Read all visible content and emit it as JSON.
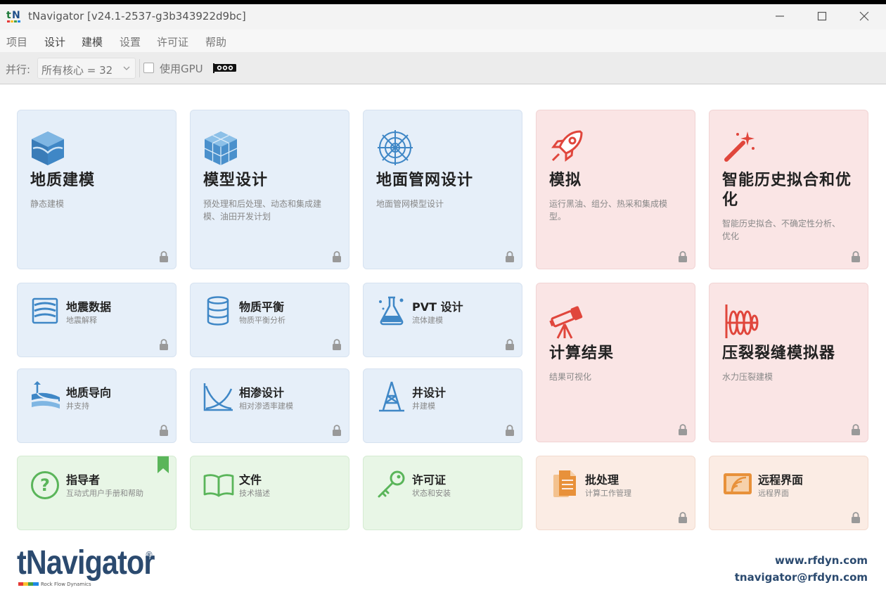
{
  "window": {
    "title": "tNavigator [v24.1-2537-g3b343922d9bc]",
    "minimize_label": "—",
    "maximize_label": "☐",
    "close_label": "✕"
  },
  "menu": {
    "items": [
      "项目",
      "设计",
      "建模",
      "设置",
      "许可证",
      "帮助"
    ],
    "highlighted": [
      "设计",
      "建模"
    ]
  },
  "toolbar": {
    "parallel_label": "并行:",
    "cores_value": "所有核心 = 32",
    "gpu_label": "使用GPU",
    "gpu_checked": false
  },
  "tiles": {
    "geo": {
      "title": "地质建模",
      "desc": "静态建模"
    },
    "model": {
      "title": "模型设计",
      "desc1": "预处理和后处理、动态和集成建",
      "desc2": "模、油田开发计划"
    },
    "network": {
      "title": "地面管网设计",
      "desc": "地面管网模型设计"
    },
    "sim": {
      "title": "模拟",
      "desc1": "运行黑油、组分、热采和集成模",
      "desc2": "型。"
    },
    "ahm": {
      "title1": "智能历史拟合和优",
      "title2": "化",
      "desc1": "智能历史拟合、不确定性分析、",
      "desc2": "优化"
    },
    "seismic": {
      "title": "地震数据",
      "desc": "地震解释"
    },
    "balance": {
      "title": "物质平衡",
      "desc": "物质平衡分析"
    },
    "pvt": {
      "title": "PVT 设计",
      "desc": "流体建模"
    },
    "results": {
      "title": "计算结果",
      "desc": "结果可视化"
    },
    "frac": {
      "title": "压裂裂缝模拟器",
      "desc": "水力压裂建模"
    },
    "geosteer": {
      "title": "地质导向",
      "desc": "井支持"
    },
    "relperm": {
      "title": "相渗设计",
      "desc": "相对渗透率建模"
    },
    "well": {
      "title": "井设计",
      "desc": "井建模"
    },
    "guide": {
      "title": "指导者",
      "desc": "互动式用户手册和帮助"
    },
    "docs": {
      "title": "文件",
      "desc": "技术描述"
    },
    "license": {
      "title": "许可证",
      "desc": "状态和安装"
    },
    "batch": {
      "title": "批处理",
      "desc": "计算工作管理"
    },
    "remote": {
      "title": "远程界面",
      "desc": "远程界面"
    }
  },
  "footer": {
    "brand": "tNavigator",
    "brand_mark": "®",
    "brand_sub": "Rock Flow Dynamics",
    "website": "www.rfdyn.com",
    "email": "tnavigator@rfdyn.com"
  },
  "colors": {
    "blue_tile": "#e6eff9",
    "red_tile": "#fae5e5",
    "green_tile": "#e8f6e6",
    "peach_tile": "#fbece4",
    "blue_icon": "#3f87c6",
    "red_icon": "#e0463c",
    "green_icon": "#5ab55a",
    "orange_icon": "#e8913a"
  }
}
